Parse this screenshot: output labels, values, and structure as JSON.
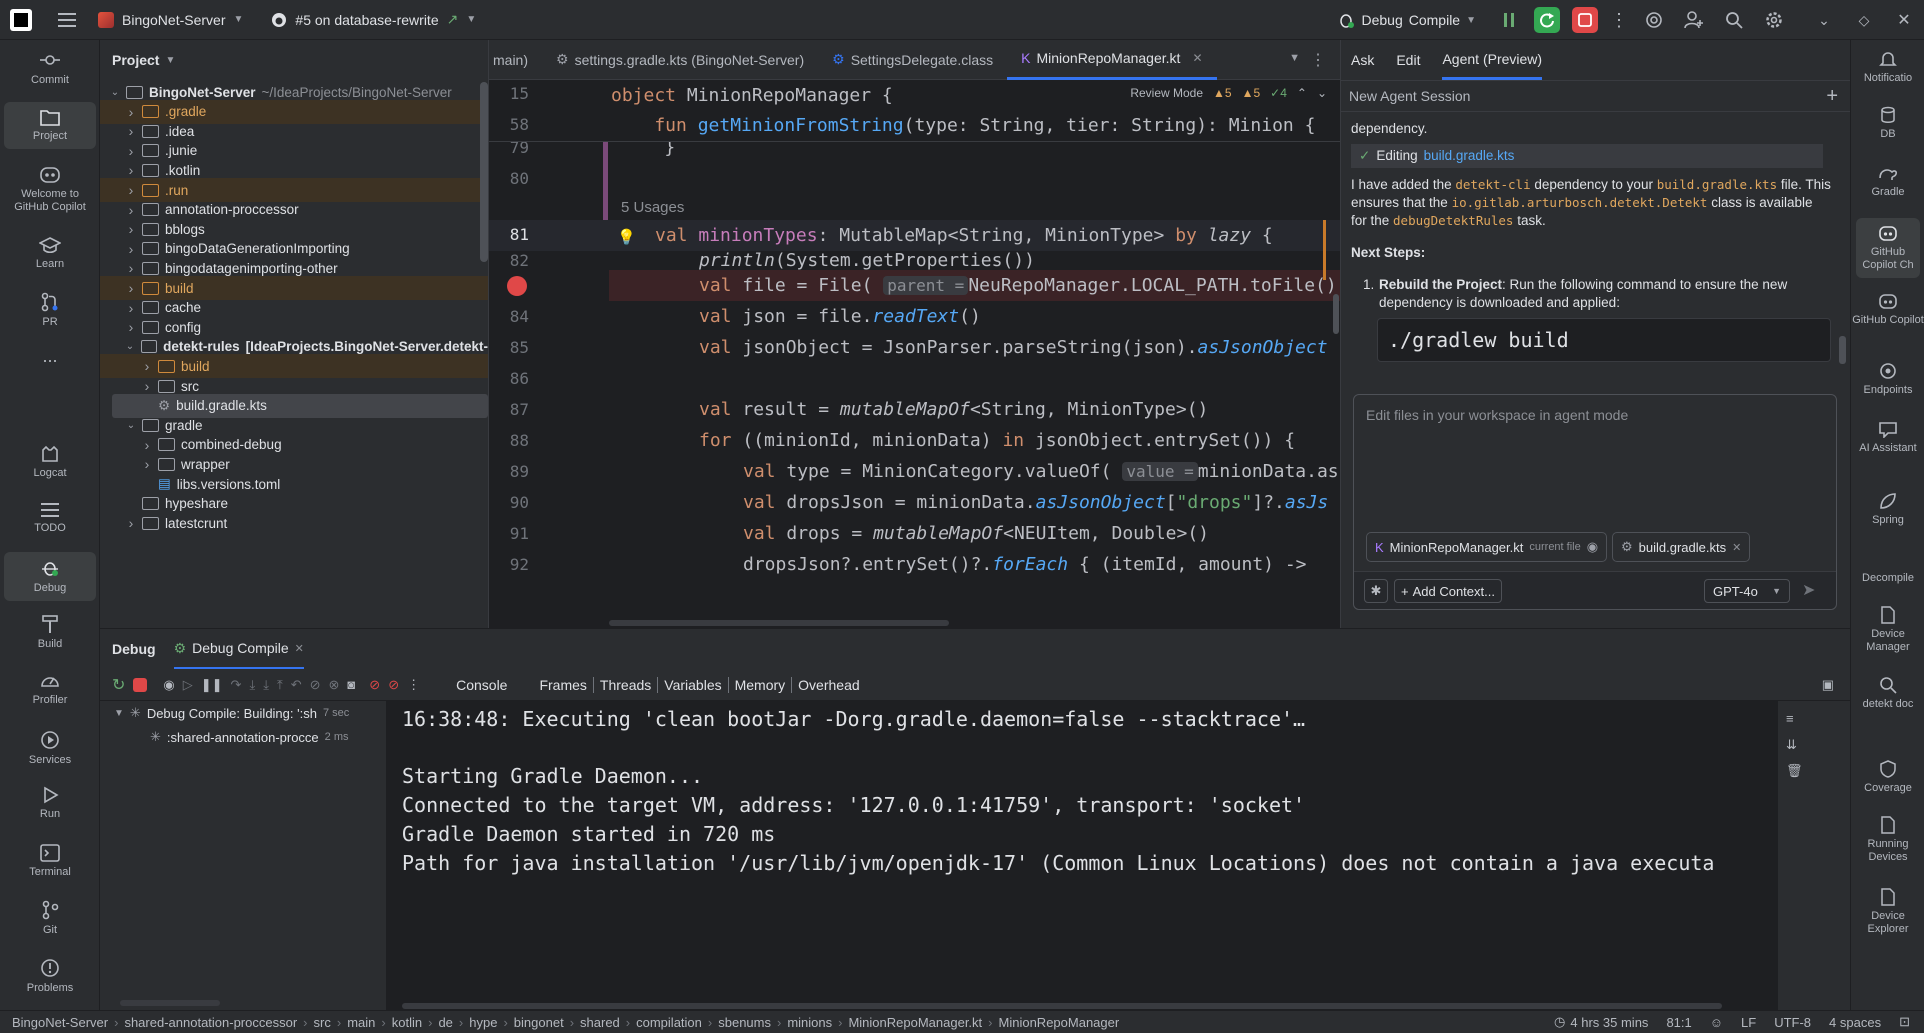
{
  "titlebar": {
    "project": "BingoNet-Server",
    "branch": "#5 on database-rewrite",
    "run_config_prefix": "Debug",
    "run_config": "Compile"
  },
  "left_strip": [
    "Commit",
    "Project",
    "Welcome to GitHub Copilot",
    "Learn",
    "PR",
    "...",
    "Logcat",
    "TODO",
    "Debug",
    "Build",
    "Profiler",
    "Services",
    "Run",
    "Terminal",
    "Git",
    "Problems"
  ],
  "project_panel": {
    "title": "Project",
    "rows": [
      {
        "label": "BingoNet-Server",
        "path": "~/IdeaProjects/BingoNet-Server"
      },
      {
        "label": ".gradle"
      },
      {
        "label": ".idea"
      },
      {
        "label": ".junie"
      },
      {
        "label": ".kotlin"
      },
      {
        "label": ".run"
      },
      {
        "label": "annotation-proccessor"
      },
      {
        "label": "bblogs"
      },
      {
        "label": "bingoDataGenerationImporting"
      },
      {
        "label": "bingodatagenimporting-other"
      },
      {
        "label": "build"
      },
      {
        "label": "cache"
      },
      {
        "label": "config"
      },
      {
        "label": "detekt-rules",
        "path": "[IdeaProjects.BingoNet-Server.detekt-"
      },
      {
        "label": "build"
      },
      {
        "label": "src"
      },
      {
        "label": "build.gradle.kts"
      },
      {
        "label": "gradle"
      },
      {
        "label": "combined-debug"
      },
      {
        "label": "wrapper"
      },
      {
        "label": "libs.versions.toml"
      },
      {
        "label": "hypeshare"
      },
      {
        "label": "latestcrunt"
      }
    ]
  },
  "editor": {
    "tabs": [
      {
        "label": "main)"
      },
      {
        "label": "settings.gradle.kts (BingoNet-Server)"
      },
      {
        "label": "SettingsDelegate.class"
      },
      {
        "label": "MinionRepoManager.kt"
      }
    ],
    "review_mode": "Review Mode",
    "warnings": [
      "▲5",
      "▲5",
      "✓4"
    ],
    "sticky_lines": [
      {
        "ln": "15",
        "code": "object MinionRepoManager {"
      },
      {
        "ln": "58",
        "code": "    fun getMinionFromString(type: String, tier: String): Minion {"
      }
    ],
    "usages": "5 Usages",
    "lines": [
      {
        "ln": "79",
        "code": "    }"
      },
      {
        "ln": "80",
        "code": ""
      },
      {
        "ln": "81",
        "code": "val minionTypes: MutableMap<String, MinionType> by lazy {"
      },
      {
        "ln": "82",
        "code": "println(System.getProperties())"
      },
      {
        "ln": "",
        "code": "val file = File("
      },
      {
        "ln": "84",
        "code": "val json = file.readText()"
      },
      {
        "ln": "85",
        "code": "val jsonObject = JsonParser.parseString(json).asJsonObject"
      },
      {
        "ln": "86",
        "code": ""
      },
      {
        "ln": "87",
        "code": "val result = mutableMapOf<String, MinionType>()"
      },
      {
        "ln": "88",
        "code": "for ((minionId, minionData) in jsonObject.entrySet()) {"
      },
      {
        "ln": "89",
        "code": "val type = MinionCategory.valueOf("
      },
      {
        "ln": "90",
        "code": "val dropsJson = minionData.asJsonObject[\"drops\"]?.asJs"
      },
      {
        "ln": "91",
        "code": "val drops = mutableMapOf<NEUItem, Double>()"
      },
      {
        "ln": "92",
        "code": "dropsJson?.entrySet()?.forEach { (itemId, amount) ->"
      }
    ],
    "hints": {
      "parent": "parent =",
      "value": "value ="
    },
    "code_fragments": {
      "line83_tail": "NeuRepoManager.LOCAL_PATH.toFile()",
      "line89_tail": "minionData.as"
    }
  },
  "copilot": {
    "tabs": [
      "Ask",
      "Edit",
      "Agent (Preview)"
    ],
    "session": "New Agent Session",
    "dependency_text": "dependency.",
    "editing_label": "Editing",
    "editing_file": "build.gradle.kts",
    "para1": {
      "a": "I have added the ",
      "b": "detekt-cli",
      "c": " dependency to your ",
      "d": "build.gradle.kts",
      "e": " file. This ensures that the ",
      "f": "io.gitlab.arturbosch.detekt.Detekt",
      "g": " class is available for the ",
      "h": "debugDetektRules",
      "i": " task."
    },
    "next_steps": "Next Steps:",
    "step1_bold": "Rebuild the Project",
    "step1_text": ": Run the following command to ensure the new dependency is downloaded and applied:",
    "command": "./gradlew build",
    "input_placeholder": "Edit files in your workspace in agent mode",
    "chip1": "MinionRepoManager.kt",
    "chip1_note": "current file",
    "chip2": "build.gradle.kts",
    "add_context": "Add Context...",
    "model": "GPT-4o"
  },
  "right_strip": [
    "Notificatio",
    "DB",
    "Gradle",
    "GitHub Copilot Ch",
    "GitHub Copilot",
    "Endpoints",
    "AI Assistant",
    "Spring",
    "Decompile",
    "Device Manager",
    "detekt doc",
    "Coverage",
    "Running Devices",
    "Device Explorer"
  ],
  "debug_panel": {
    "title": "Debug",
    "session_tab": "Debug  Compile",
    "tabs": [
      "Console",
      "Frames",
      "Threads",
      "Variables",
      "Memory",
      "Overhead"
    ],
    "tree": [
      {
        "label": "Debug  Compile: Building: ':sh",
        "time": "7 sec"
      },
      {
        "label": ":shared-annotation-procce",
        "time": "2 ms"
      }
    ],
    "console_lines": [
      "16:38:48: Executing 'clean bootJar -Dorg.gradle.daemon=false --stacktrace'…",
      "",
      "Starting Gradle Daemon...",
      "Connected to the target VM, address: '127.0.0.1:41759', transport: 'socket'",
      "Gradle Daemon started in 720 ms",
      "Path for java installation '/usr/lib/jvm/openjdk-17' (Common Linux Locations) does not contain a java executa"
    ]
  },
  "statusbar": {
    "crumbs": [
      "BingoNet-Server",
      "shared-annotation-proccessor",
      "src",
      "main",
      "kotlin",
      "de",
      "hype",
      "bingonet",
      "shared",
      "compilation",
      "sbenums",
      "minions",
      "MinionRepoManager.kt",
      "MinionRepoManager"
    ],
    "time": "4 hrs 35 mins",
    "position": "81:1",
    "line_sep": "LF",
    "encoding": "UTF-8",
    "indent": "4 spaces"
  }
}
